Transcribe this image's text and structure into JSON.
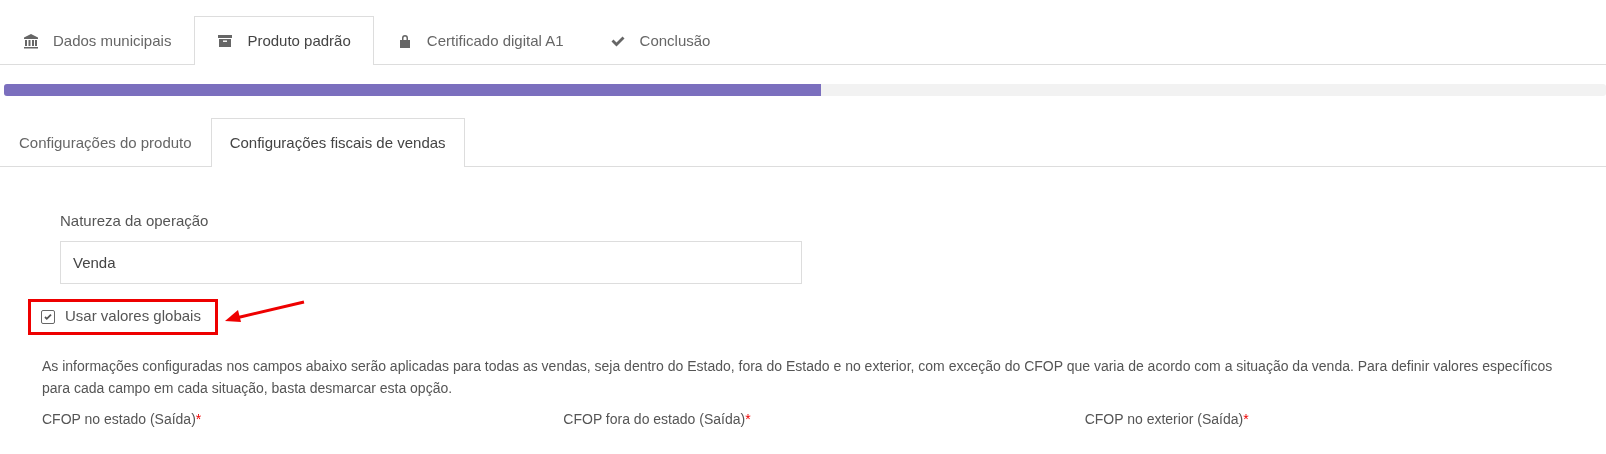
{
  "steps": [
    {
      "label": "Dados municipais",
      "selected": false
    },
    {
      "label": "Produto padrão",
      "selected": true
    },
    {
      "label": "Certificado digital A1",
      "selected": false
    },
    {
      "label": "Conclusão",
      "selected": false
    }
  ],
  "progress": {
    "level": 0.51
  },
  "subtabs": [
    {
      "label": "Configurações do produto",
      "selected": false
    },
    {
      "label": "Configurações fiscais de vendas",
      "selected": true
    }
  ],
  "operation_field": {
    "label": "Natureza da operação",
    "value": "Venda"
  },
  "global_values": {
    "label": "Usar valores globais",
    "checked": true,
    "highlighted": true
  },
  "help_text": "As informações configuradas nos campos abaixo serão aplicadas para todas as vendas, seja dentro do Estado, fora do Estado e no exterior, com exceção do CFOP que varia de acordo com a situação da venda. Para definir valores específicos para cada campo em cada situação, basta desmarcar esta opção.",
  "cfop_fields": [
    {
      "label": "CFOP no estado (Saída)",
      "required_mark": "*"
    },
    {
      "label": "CFOP fora do estado (Saída)",
      "required_mark": "*"
    },
    {
      "label": "CFOP no exterior (Saída)",
      "required_mark": "*"
    }
  ]
}
